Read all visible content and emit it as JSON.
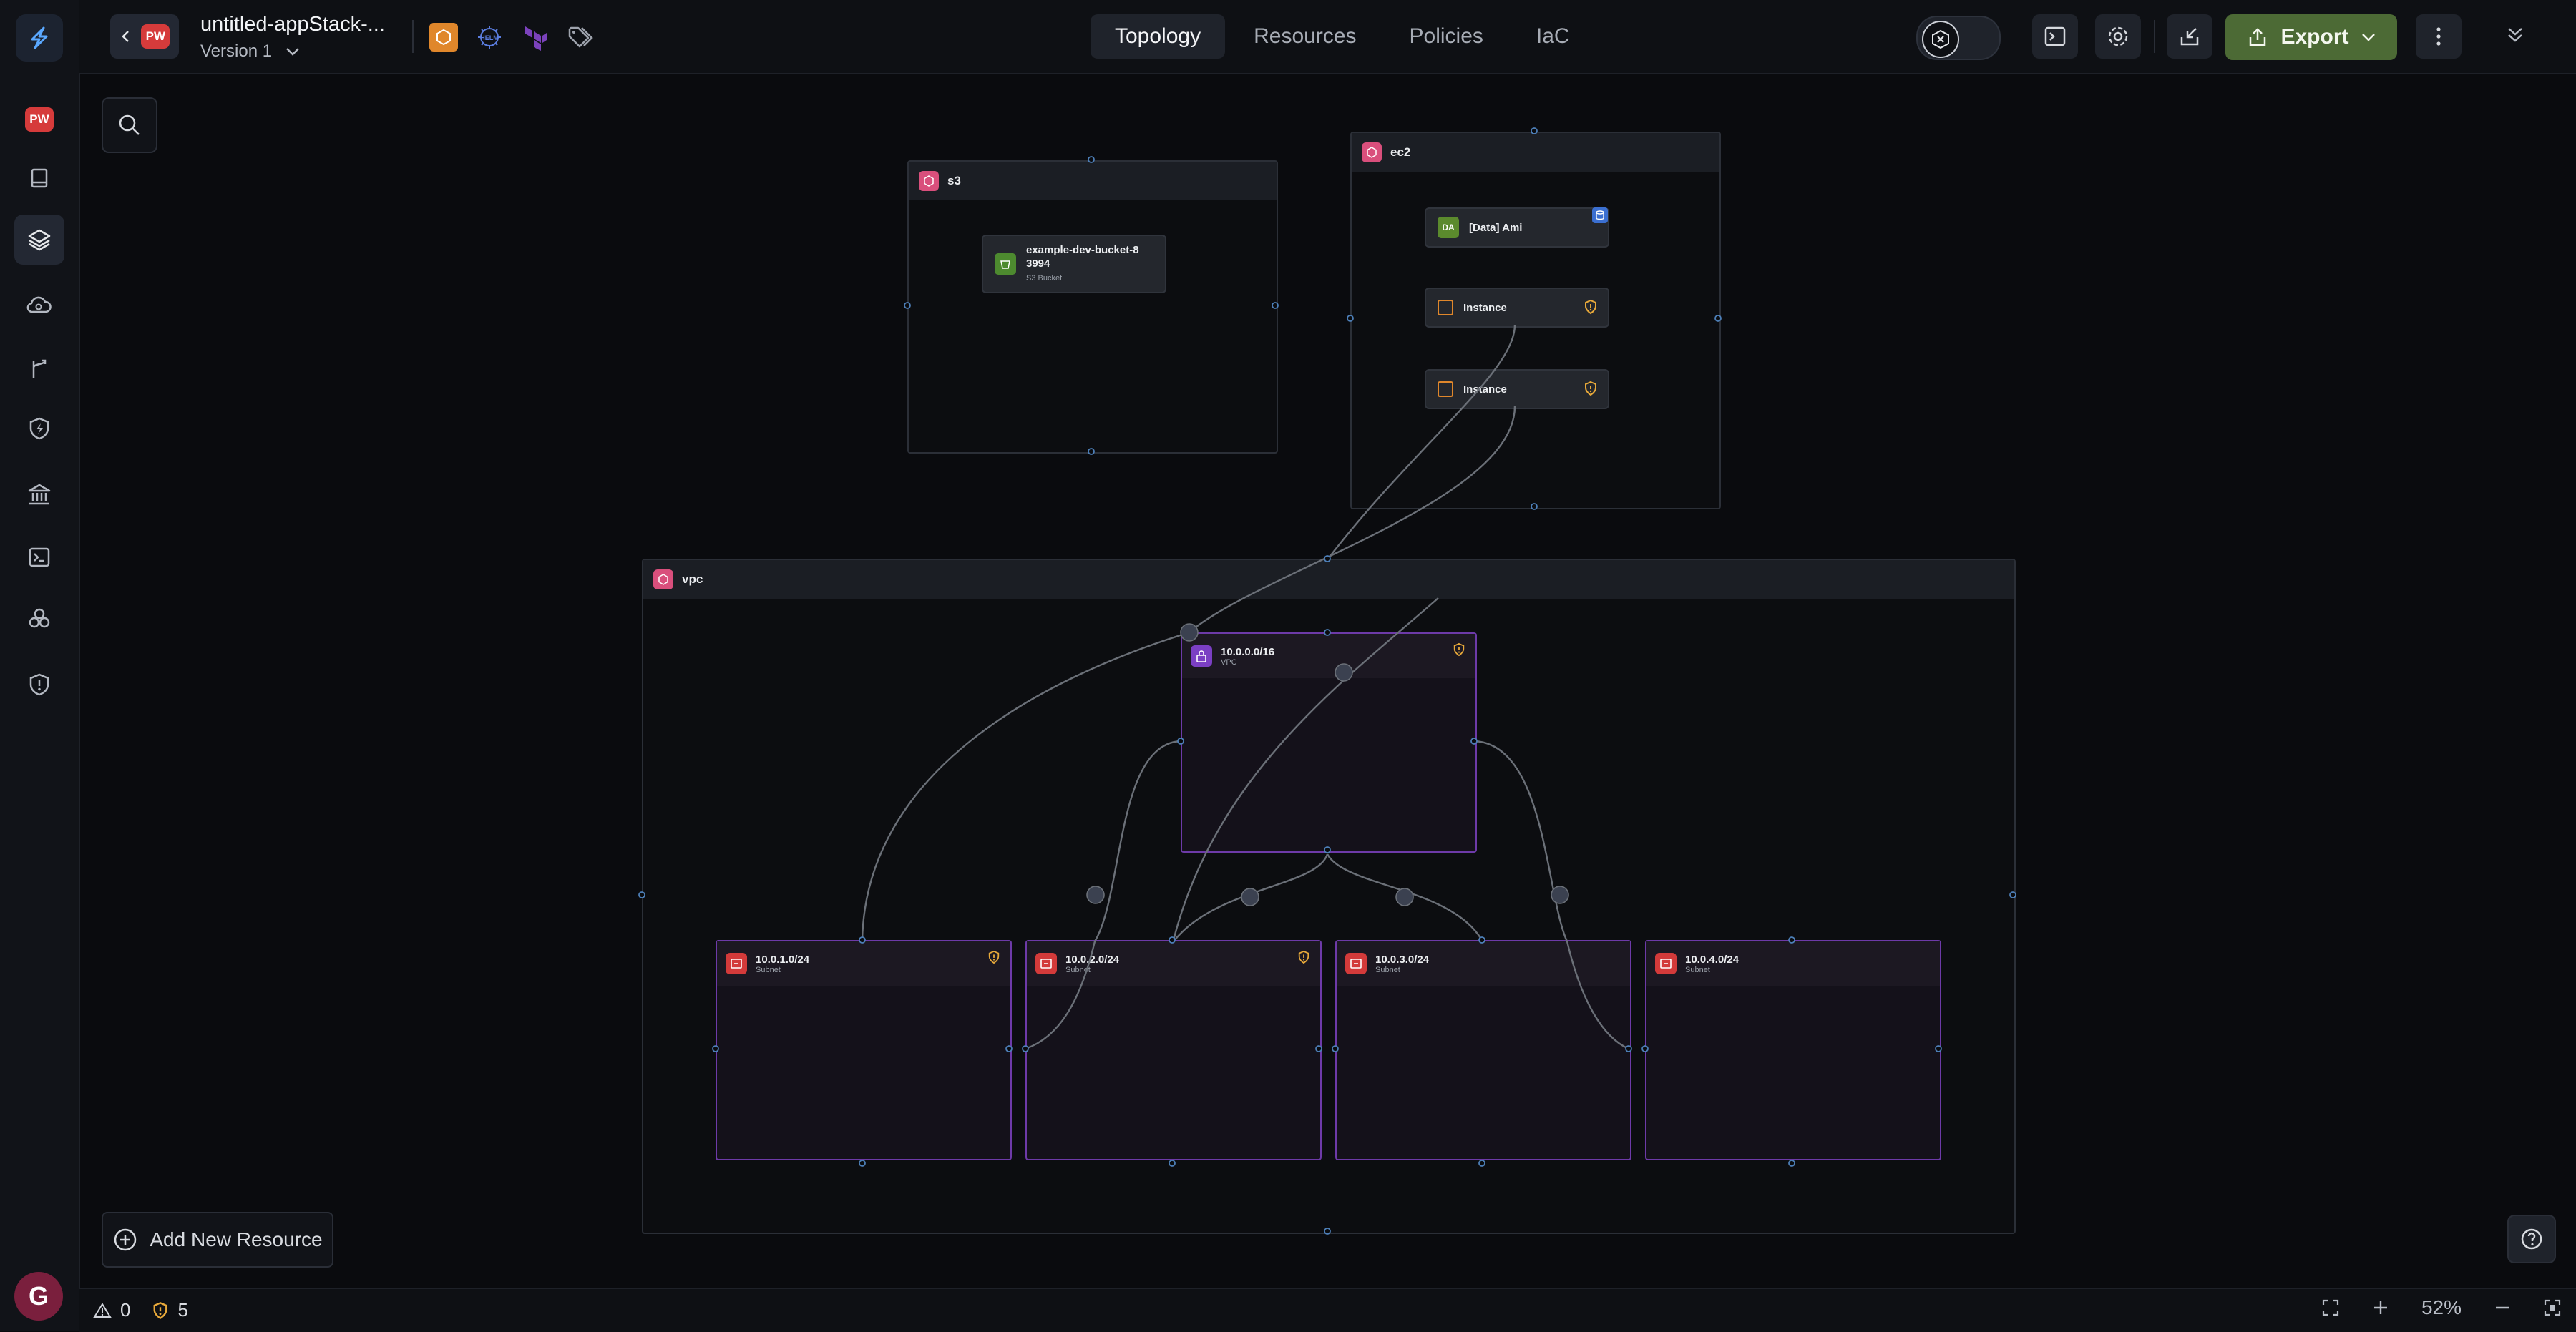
{
  "app": {
    "title": "untitled-appStack-...",
    "version_label": "Version 1",
    "project_badge": "PW",
    "helm_label": "HELM"
  },
  "tabs": [
    {
      "label": "Topology",
      "active": true
    },
    {
      "label": "Resources",
      "active": false
    },
    {
      "label": "Policies",
      "active": false
    },
    {
      "label": "IaC",
      "active": false
    }
  ],
  "toolbar": {
    "export_label": "Export",
    "accent_color": "#4c6a35"
  },
  "rail": {
    "avatar_initial": "G",
    "items": [
      "pw-badge",
      "book-icon",
      "layers-icon",
      "cloud-search-icon",
      "merge-icon",
      "shield-bolt-icon",
      "bank-icon",
      "terminal-icon",
      "cubes-icon",
      "shield-alert-icon"
    ]
  },
  "canvas": {
    "groups": {
      "s3": {
        "label": "s3"
      },
      "ec2": {
        "label": "ec2"
      },
      "vpc": {
        "label": "vpc"
      }
    },
    "nodes": {
      "bucket": {
        "name": "example-dev-bucket-8",
        "name2": "3994",
        "type": "S3 Bucket"
      },
      "ami": {
        "name": "[Data] Ami",
        "badge": "DA"
      },
      "instance1": {
        "name": "Instance"
      },
      "instance2": {
        "name": "Instance"
      },
      "vpc_cidr": {
        "name": "10.0.0.0/16",
        "type": "VPC"
      },
      "subnets": [
        {
          "name": "10.0.1.0/24",
          "type": "Subnet"
        },
        {
          "name": "10.0.2.0/24",
          "type": "Subnet"
        },
        {
          "name": "10.0.3.0/24",
          "type": "Subnet"
        },
        {
          "name": "10.0.4.0/24",
          "type": "Subnet"
        }
      ]
    },
    "add_resource_label": "Add New Resource"
  },
  "status": {
    "errors": "0",
    "warnings": "5",
    "zoom": "52%"
  }
}
